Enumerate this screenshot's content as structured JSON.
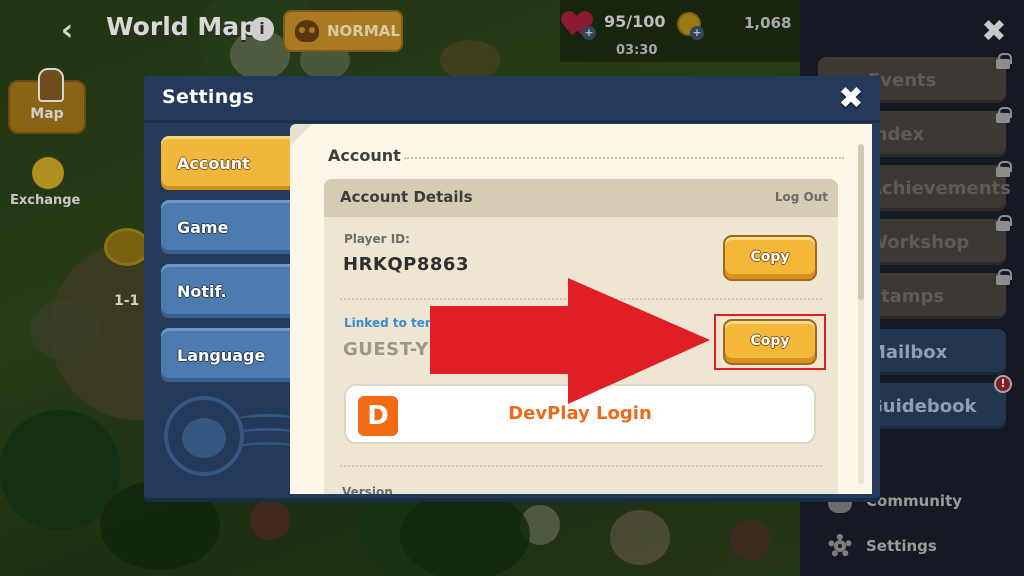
{
  "hud": {
    "title": "World Map",
    "mode_label": "NORMAL",
    "energy": "95/100",
    "energy_timer": "03:30",
    "coins": "1,068"
  },
  "map": {
    "map_button_label": "Map",
    "exchange_label": "Exchange",
    "stage_label": "1-1"
  },
  "side_menu": {
    "items": [
      {
        "label": "Events",
        "locked": true
      },
      {
        "label": "Index",
        "locked": true
      },
      {
        "label": "Achievements",
        "locked": true
      },
      {
        "label": "Workshop",
        "locked": true
      },
      {
        "label": "Stamps",
        "locked": true
      },
      {
        "label": "Mailbox",
        "locked": false
      },
      {
        "label": "Guidebook",
        "locked": false,
        "alert": "!"
      }
    ],
    "bottom": [
      {
        "label": "Community",
        "icon": "cup-icon"
      },
      {
        "label": "Settings",
        "icon": "gear-icon"
      }
    ]
  },
  "settings": {
    "title": "Settings",
    "tabs": [
      {
        "label": "Account",
        "active": true
      },
      {
        "label": "Game",
        "active": false
      },
      {
        "label": "Notif.",
        "active": false
      },
      {
        "label": "Language",
        "active": false
      }
    ],
    "section_title": "Account",
    "account_details": {
      "header": "Account Details",
      "logout_label": "Log Out",
      "player_id_label": "Player ID:",
      "player_id": "HRKQP8863",
      "copy_label": "Copy",
      "linked_label": "Linked to tem",
      "linked_value": "GUEST-Y",
      "copy_label_2": "Copy",
      "devplay_logo": "D",
      "devplay_label": "DevPlay Login",
      "version_label": "Version"
    }
  },
  "colors": {
    "accent_yellow": "#f3b73a",
    "dialog_blue": "#233a5a",
    "tab_blue": "#4d7bb0",
    "devplay_orange": "#ee6a1b",
    "annotation_red": "#e01e25",
    "linked_blue": "#3d8bd0"
  }
}
